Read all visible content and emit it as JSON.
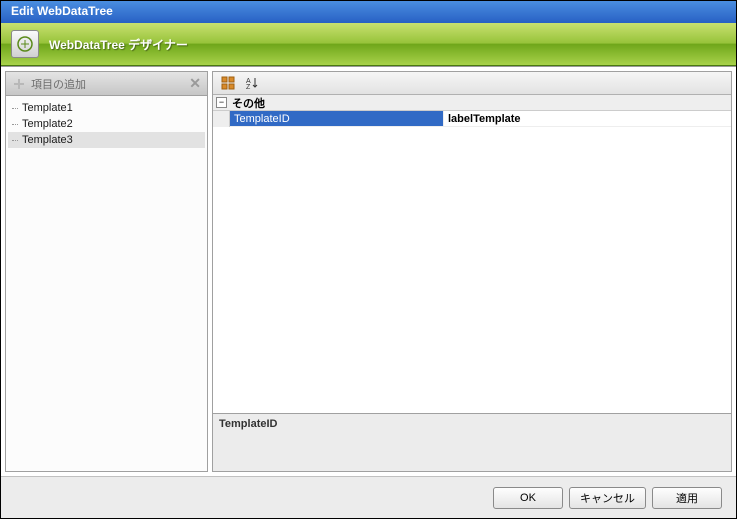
{
  "window": {
    "title": "Edit WebDataTree"
  },
  "designer": {
    "title": "WebDataTree デザイナー"
  },
  "sidebar": {
    "add_label": "項目の追加",
    "items": [
      {
        "label": "Template1"
      },
      {
        "label": "Template2"
      },
      {
        "label": "Template3"
      }
    ],
    "selected_index": 2
  },
  "property_grid": {
    "category": "その他",
    "rows": [
      {
        "name": "TemplateID",
        "value": "labelTemplate",
        "selected": true
      }
    ]
  },
  "description": {
    "title": "TemplateID"
  },
  "buttons": {
    "ok": "OK",
    "cancel": "キャンセル",
    "apply": "適用"
  }
}
